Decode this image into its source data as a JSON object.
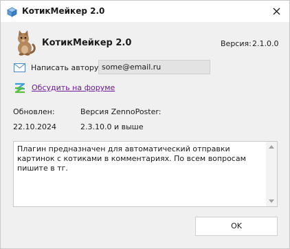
{
  "window": {
    "title": "КотикМейкер 2.0",
    "icons": {
      "app": "cube-icon",
      "close": "close-icon"
    }
  },
  "header": {
    "app_name": "КотикМейкер 2.0",
    "version_label": "Версия:",
    "version_value": "2.1.0.0",
    "logo": "cat-logo"
  },
  "author": {
    "label": "Написать автору:",
    "email": "some@email.ru",
    "icon": "mail-icon"
  },
  "forum": {
    "link_text": "Обсудить на форуме",
    "icon": "zennoposter-icon",
    "link_color": "#6a1b9a"
  },
  "info": {
    "updated_label": "Обновлен:",
    "updated_value": "22.10.2024",
    "zp_label": "Версия ZennoPoster:",
    "zp_value": "2.3.10.0 и выше"
  },
  "description": {
    "text": "Плагин предназначен для автоматический отправки картинок с котиками в комментариях. По всем вопросам пишите в тг."
  },
  "buttons": {
    "ok": "OK"
  }
}
